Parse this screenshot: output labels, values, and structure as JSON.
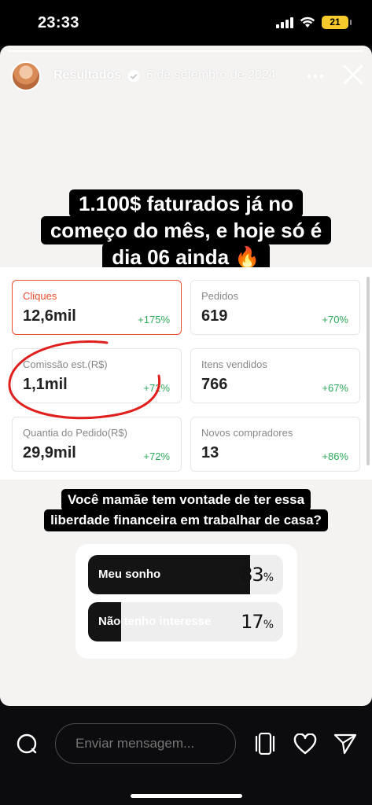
{
  "status_bar": {
    "time": "23:33",
    "battery": "21"
  },
  "header": {
    "username": "Resultados",
    "date": "6 de setembro de 2024"
  },
  "headline": {
    "lines": [
      "1.100$ faturados já no",
      "começo do mês, e hoje só é",
      "dia 06 ainda 🔥"
    ]
  },
  "metrics": [
    {
      "label": "Cliques",
      "value": "12,6mil",
      "change": "+175%"
    },
    {
      "label": "Pedidos",
      "value": "619",
      "change": "+70%"
    },
    {
      "label": "Comissão est.(R$)",
      "value": "1,1mil",
      "change": "+72%"
    },
    {
      "label": "Itens vendidos",
      "value": "766",
      "change": "+67%"
    },
    {
      "label": "Quantia do Pedido(R$)",
      "value": "29,9mil",
      "change": "+72%"
    },
    {
      "label": "Novos compradores",
      "value": "13",
      "change": "+86%"
    }
  ],
  "question": {
    "lines": [
      "Você mamãe tem vontade de ter essa",
      "liberdade financeira em trabalhar de casa?"
    ]
  },
  "poll": {
    "options": [
      {
        "label": "Meu sonho",
        "percent": "83",
        "fraction": 0.83
      },
      {
        "label": "Não tenho interesse",
        "percent": "17",
        "fraction": 0.17
      }
    ],
    "percent_sign": "%"
  },
  "composer": {
    "placeholder": "Enviar mensagem..."
  },
  "colors": {
    "accent": "#ee4d2d",
    "positive": "#2eaa5a",
    "annotation": "#e0201e",
    "battery": "#f6c92c"
  }
}
